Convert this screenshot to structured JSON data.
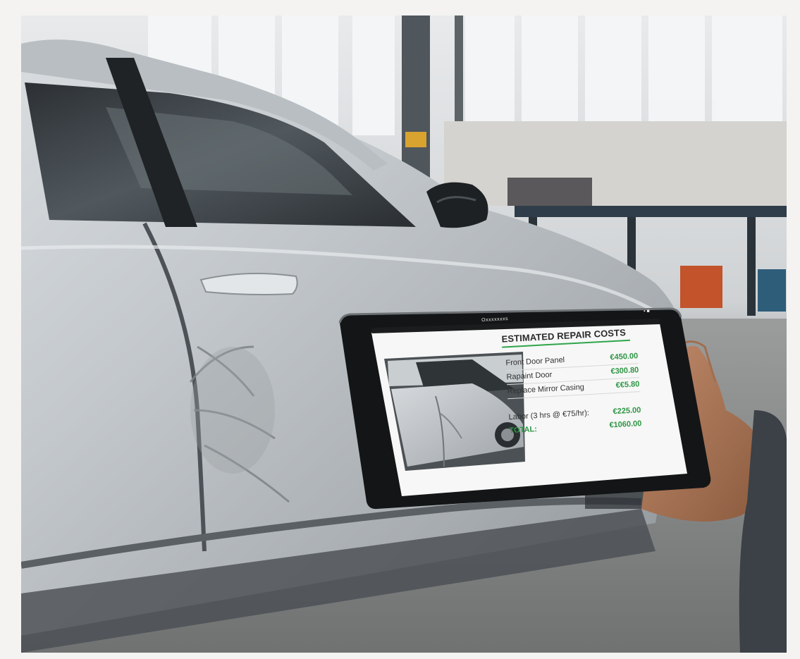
{
  "tablet": {
    "status_title": "Oxxxxxxxs",
    "status_right": "• ■"
  },
  "estimate": {
    "title": "ESTIMATED REPAIR COSTS",
    "items": [
      {
        "label": "Front Door Panel",
        "price": "€450.00"
      },
      {
        "label": "Rapaint Door",
        "price": "€300.80"
      },
      {
        "label": "Replace Mirror Casing",
        "price": "€€5.80"
      },
      {
        "label": "Labor (3 hrs @ €75/hr):",
        "price": "€225.00"
      }
    ],
    "total_label": "TOTAL:",
    "total_value": "€1060.00"
  },
  "colors": {
    "price_green": "#2f9646",
    "title_rule_green": "#2fa54b"
  }
}
